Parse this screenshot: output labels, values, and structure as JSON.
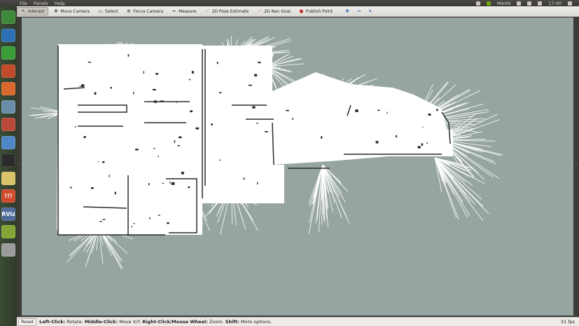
{
  "system_bar": {
    "menus": [
      "File",
      "Panels",
      "Help"
    ],
    "network_label": "MAXN",
    "clock": "17:00"
  },
  "launcher": {
    "items": [
      {
        "name": "files-icon",
        "glyph": "",
        "color": "#3f8a3a"
      },
      {
        "name": "libreoffice-writer-icon",
        "glyph": "",
        "color": "#2d6fb3"
      },
      {
        "name": "libreoffice-calc-icon",
        "glyph": "",
        "color": "#3a9d3a"
      },
      {
        "name": "archive-icon",
        "glyph": "",
        "color": "#c04a2a"
      },
      {
        "name": "libreoffice-impress-icon",
        "glyph": "",
        "color": "#d9682c"
      },
      {
        "name": "screenshot-icon",
        "glyph": "",
        "color": "#6a8ea8"
      },
      {
        "name": "settings-icon",
        "glyph": "",
        "color": "#b8483a"
      },
      {
        "name": "chromium-icon",
        "glyph": "",
        "color": "#4f86c6"
      },
      {
        "name": "terminal-icon",
        "glyph": "",
        "color": "#2b2b2b"
      },
      {
        "name": "text-editor-icon",
        "glyph": "",
        "color": "#d8c36a"
      },
      {
        "name": "mplayer-icon",
        "glyph": "!!!",
        "color": "#d04a2e"
      },
      {
        "name": "rviz-icon",
        "glyph": "RViz",
        "color": "#4c6a9a"
      },
      {
        "name": "camera-icon",
        "glyph": "",
        "color": "#86a536"
      },
      {
        "name": "drive-icon",
        "glyph": "",
        "color": "#9b9b9b"
      }
    ]
  },
  "toolbar": {
    "tools": [
      {
        "id": "interact",
        "label": "Interact",
        "active": true,
        "icon": "cursor-icon",
        "glyph": "↖",
        "color": "#333333"
      },
      {
        "id": "move-camera",
        "label": "Move Camera",
        "active": false,
        "icon": "move-camera-icon",
        "glyph": "✥",
        "color": "#444444"
      },
      {
        "id": "select",
        "label": "Select",
        "active": false,
        "icon": "select-icon",
        "glyph": "▭",
        "color": "#444444"
      },
      {
        "id": "focus-camera",
        "label": "Focus Camera",
        "active": false,
        "icon": "focus-camera-icon",
        "glyph": "⊕",
        "color": "#444444"
      },
      {
        "id": "measure",
        "label": "Measure",
        "active": false,
        "icon": "ruler-icon",
        "glyph": "━",
        "color": "#555555"
      },
      {
        "id": "pose-estimate",
        "label": "2D Pose Estimate",
        "active": false,
        "icon": "green-arrow-icon",
        "glyph": "⟋",
        "color": "#2f9e2f"
      },
      {
        "id": "nav-goal",
        "label": "2D Nav Goal",
        "active": false,
        "icon": "pink-arrow-icon",
        "glyph": "⟋",
        "color": "#d2458a"
      },
      {
        "id": "publish-point",
        "label": "Publish Point",
        "active": false,
        "icon": "map-pin-icon",
        "glyph": "●",
        "color": "#c93636"
      }
    ],
    "extras": [
      {
        "name": "add-tool-icon",
        "glyph": "✚",
        "color": "#3b6fc0"
      },
      {
        "name": "remove-tool-icon",
        "glyph": "━",
        "color": "#3b6fc0"
      },
      {
        "name": "tool-properties-icon",
        "glyph": "▾",
        "color": "#3b6fc0"
      }
    ]
  },
  "status": {
    "reset_label": "Reset",
    "left_click_key": "Left-Click:",
    "left_click_desc": " Rotate. ",
    "middle_click_key": "Middle-Click:",
    "middle_click_desc": " Move X/Y. ",
    "right_click_key": "Right-Click/Mouse Wheel:",
    "right_click_desc": " Zoom. ",
    "shift_key": "Shift:",
    "shift_desc": " More options.",
    "fps": "31 fps"
  },
  "view": {
    "background_color": "#96a5a2",
    "map_free_color": "#ffffff",
    "map_wall_color": "#2a2a2a"
  }
}
